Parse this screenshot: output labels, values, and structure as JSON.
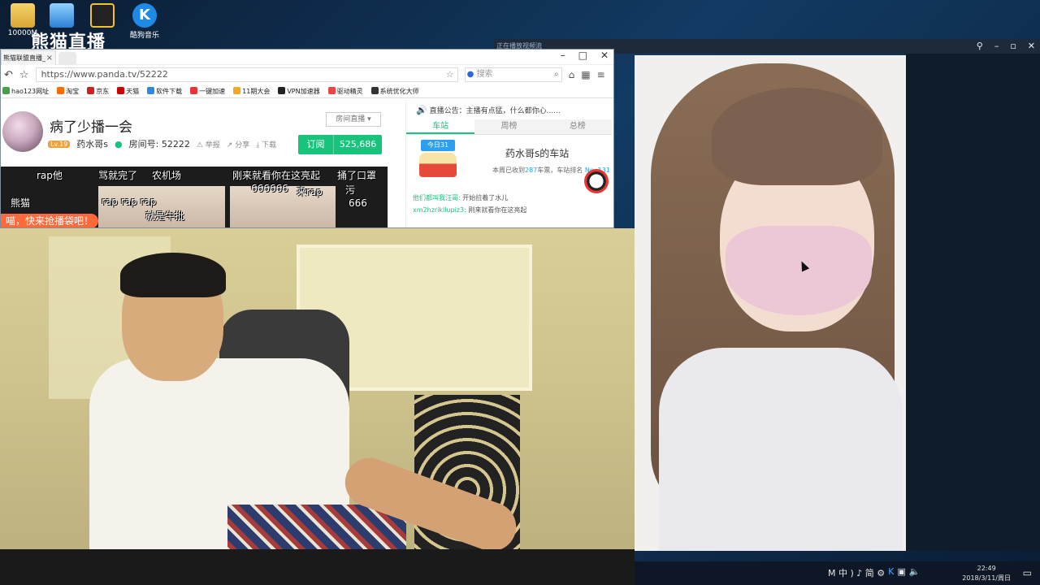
{
  "desktop": {
    "icons": [
      {
        "label": "10000M"
      },
      {
        "label": ""
      },
      {
        "label": ""
      },
      {
        "label": "酷狗音乐"
      }
    ],
    "brand": "熊猫直播"
  },
  "browser": {
    "tab_title": "熊猫联盟直播_",
    "url": "https://www.panda.tv/52222",
    "search_placeholder": "搜索",
    "bookmarks": [
      "hao123网址",
      "淘宝",
      "京东",
      "天猫",
      "软件下载",
      "一键加速",
      "11期大会",
      "VPN加速器",
      "驱动精灵",
      "系统优化大师"
    ]
  },
  "room": {
    "title": "病了少播一会",
    "type_dropdown": "房间直播",
    "level": "Lv.19",
    "host": "药水哥s",
    "room_label": "房间号: 52222",
    "report": "举报",
    "share": "分享",
    "download": "下载",
    "subscribe_label": "订阅",
    "subscribe_count": "525,686"
  },
  "danmu": [
    "rap他",
    "骂就完了",
    "农机场",
    "刚来就看你在这亮起",
    "捅了口罩",
    "666666",
    "rap rap rap",
    "污",
    "666",
    "就是牛批",
    "熊猫",
    "来rap"
  ],
  "promo": "喵，快来抢播袋吧！",
  "side": {
    "notice": "直播公告：主播有点猛，什么都你心......",
    "tabs": [
      "车站",
      "周榜",
      "总榜"
    ],
    "calendar": "今日31",
    "station_title": "药水哥s的车站",
    "station_info_prefix": "本周已收到",
    "station_count": "287",
    "station_info_mid": "车票，车站排名",
    "station_rank": "No. 131",
    "chat": [
      {
        "user": "他们都叫我汪哥:",
        "text": "开始拉着了水儿"
      },
      {
        "user": "xm2hzrikllupiz3:",
        "text": "刚来就看你在这亮起"
      }
    ]
  },
  "player": {
    "title": "正在播放视频流"
  },
  "taskbar": {
    "tray": "M 中 ) ♪ 简 ⚙",
    "time": "22:49",
    "date": "2018/3/11/周日"
  }
}
